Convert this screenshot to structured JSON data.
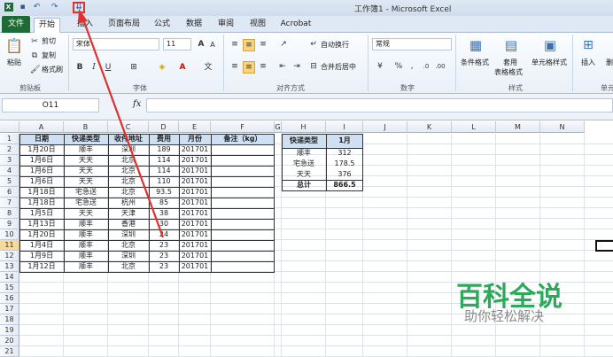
{
  "window": {
    "title": "工作簿1 - Microsoft Excel"
  },
  "qat": {
    "save": "▪",
    "undo": "↶",
    "redo": "↷",
    "customize": "⇊"
  },
  "tabs": [
    "文件",
    "开始",
    "插入",
    "页面布局",
    "公式",
    "数据",
    "审阅",
    "视图",
    "Acrobat"
  ],
  "ribbon": {
    "clipboard": {
      "paste": "粘贴",
      "cut": "剪切",
      "copy": "复制",
      "format_painter": "格式刷",
      "label": "剪贴板"
    },
    "font": {
      "name": "宋体",
      "size": "11",
      "grow": "A",
      "shrink": "A",
      "bold": "B",
      "italic": "I",
      "underline": "U",
      "label": "字体"
    },
    "alignment": {
      "wrap": "自动换行",
      "merge": "合并后居中",
      "label": "对齐方式"
    },
    "number": {
      "format": "常规",
      "percent": "%",
      "comma": ",",
      "label": "数字"
    },
    "styles": {
      "conditional": "条件格式",
      "table_format_1": "套用",
      "table_format_2": "表格格式",
      "cell_styles": "单元格样式",
      "label": "样式"
    },
    "cells": {
      "insert": "插入",
      "delete": "删",
      "label": "单元"
    }
  },
  "formula_bar": {
    "name_box": "O11",
    "fx": "fx",
    "value": ""
  },
  "columns": [
    "A",
    "B",
    "C",
    "D",
    "E",
    "F",
    "G",
    "H",
    "I",
    "J",
    "K",
    "L",
    "M",
    "N"
  ],
  "rows": [
    "1",
    "2",
    "3",
    "4",
    "5",
    "6",
    "7",
    "8",
    "9",
    "10",
    "11",
    "12",
    "13",
    "14",
    "15",
    "16",
    "17",
    "18",
    "19",
    "20",
    "21"
  ],
  "table1": {
    "headers": [
      "日期",
      "快递类型",
      "收件地址",
      "费用",
      "月份",
      "备注（kg）"
    ],
    "rows": [
      [
        "1月20日",
        "顺丰",
        "深圳",
        "189",
        "201701",
        ""
      ],
      [
        "1月6日",
        "天天",
        "北京",
        "114",
        "201701",
        ""
      ],
      [
        "1月6日",
        "天天",
        "北京",
        "114",
        "201701",
        ""
      ],
      [
        "1月6日",
        "天天",
        "北京",
        "110",
        "201701",
        ""
      ],
      [
        "1月18日",
        "宅急送",
        "北京",
        "93.5",
        "201701",
        ""
      ],
      [
        "1月18日",
        "宅急送",
        "杭州",
        "85",
        "201701",
        ""
      ],
      [
        "1月5日",
        "天天",
        "天津",
        "38",
        "201701",
        ""
      ],
      [
        "1月13日",
        "顺丰",
        "香港",
        "30",
        "201701",
        ""
      ],
      [
        "1月20日",
        "顺丰",
        "深圳",
        "24",
        "201701",
        ""
      ],
      [
        "1月4日",
        "顺丰",
        "北京",
        "23",
        "201701",
        ""
      ],
      [
        "1月9日",
        "顺丰",
        "深圳",
        "23",
        "201701",
        ""
      ],
      [
        "1月12日",
        "顺丰",
        "北京",
        "23",
        "201701",
        ""
      ]
    ]
  },
  "table2": {
    "headers": [
      "快递类型",
      "1月"
    ],
    "rows": [
      [
        "顺丰",
        "312"
      ],
      [
        "宅急送",
        "178.5"
      ],
      [
        "天天",
        "376"
      ],
      [
        "总计",
        "866.5"
      ]
    ]
  },
  "watermark": {
    "line1": "百科全说",
    "line2": "助你轻松解决"
  },
  "colors": {
    "excel_green": "#1f6b35",
    "header_fill": "#cfe0f3",
    "arrow": "#e03030",
    "watermark": "#2bab5a"
  }
}
